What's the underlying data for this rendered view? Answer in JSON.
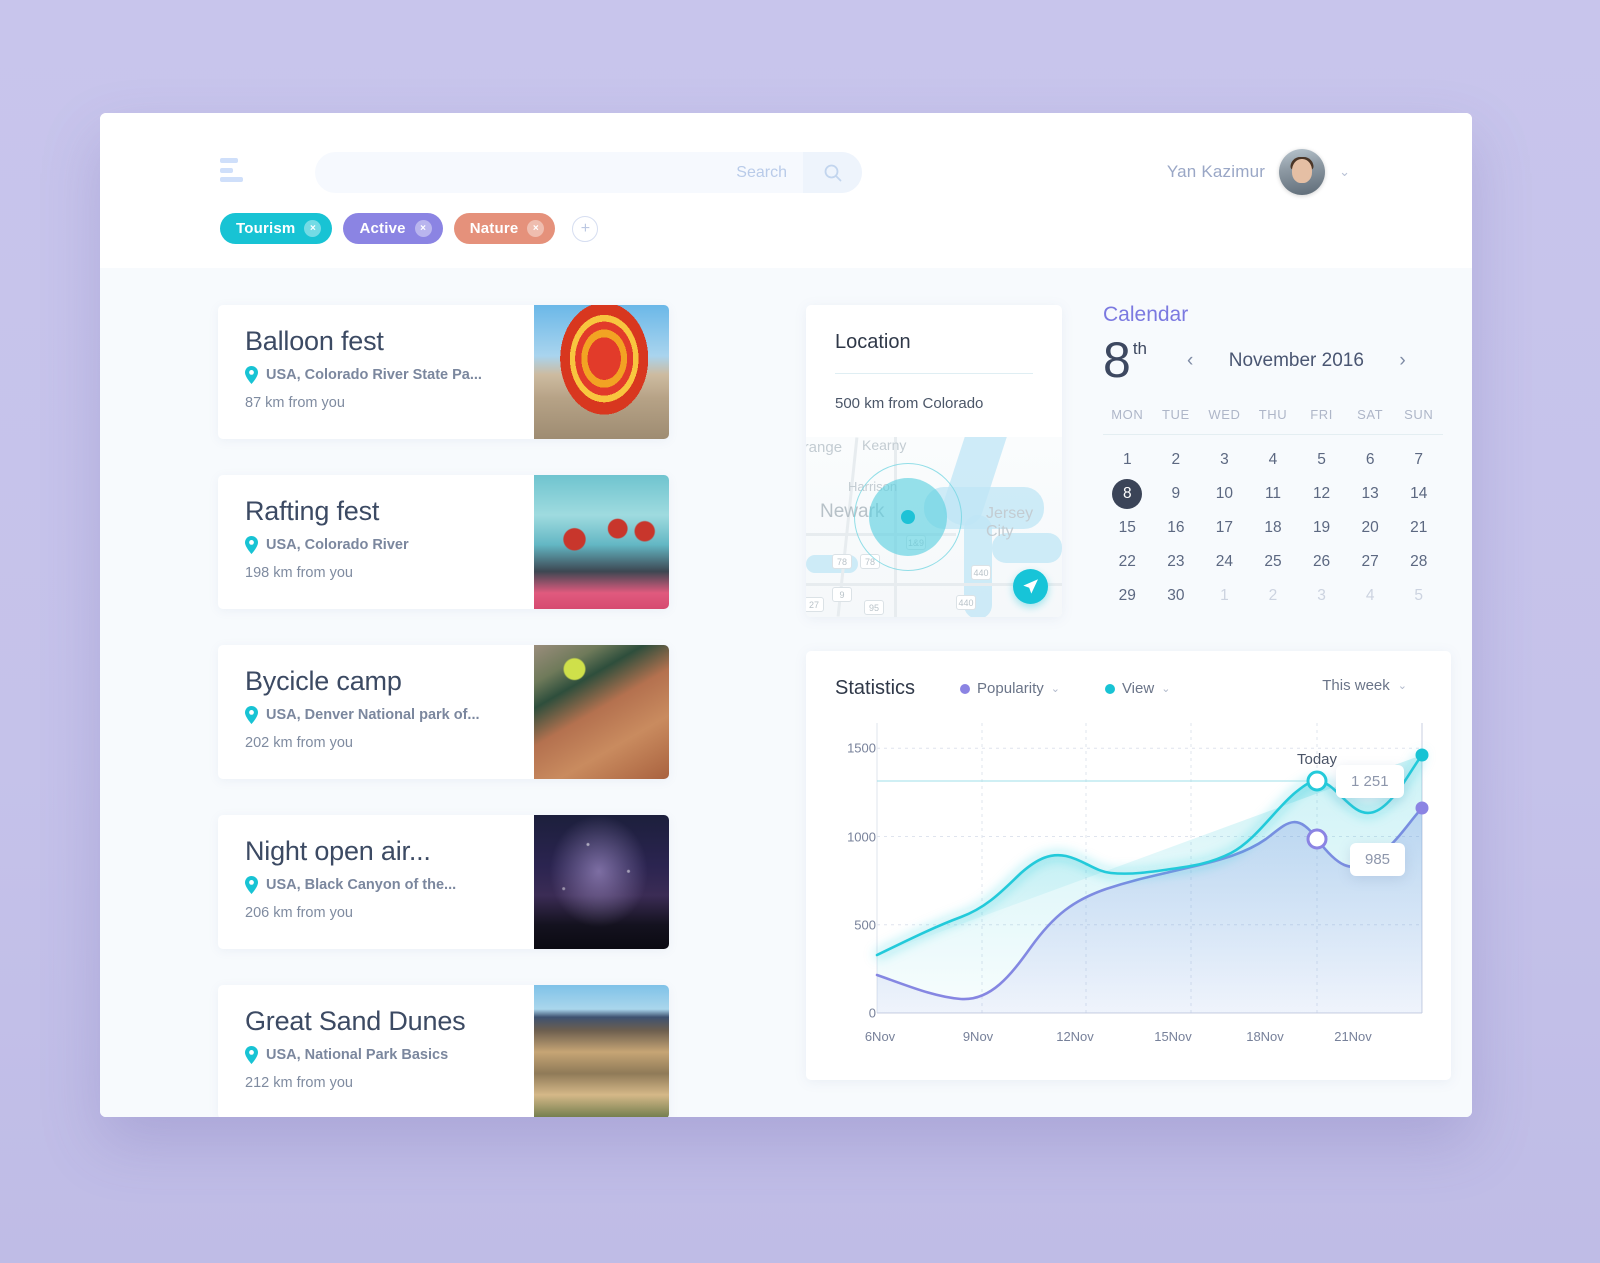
{
  "header": {
    "menu_icon": "hamburger-icon",
    "search": {
      "placeholder": "Search",
      "value": "",
      "icon": "search-icon"
    },
    "user": {
      "name": "Yan Kazimur",
      "avatar": "user-avatar",
      "chevron": "⌄"
    }
  },
  "tags": [
    {
      "label": "Tourism",
      "color": "#18c3d4",
      "remove": "×"
    },
    {
      "label": "Active",
      "color": "#8b84e3",
      "remove": "×"
    },
    {
      "label": "Nature",
      "color": "#e5917b",
      "remove": "×"
    }
  ],
  "tag_add": "+",
  "events": [
    {
      "title": "Balloon fest",
      "location": "USA, Colorado River State Pa...",
      "distance": "87 km from you",
      "photo": "ph-balloon"
    },
    {
      "title": "Rafting fest",
      "location": "USA, Colorado River",
      "distance": "198 km from you",
      "photo": "ph-raft"
    },
    {
      "title": "Bycicle camp",
      "location": "USA, Denver National park of...",
      "distance": "202 km from you",
      "photo": "ph-bike"
    },
    {
      "title": "Night open air...",
      "location": "USA, Black Canyon of the...",
      "distance": "206 km from you",
      "photo": "ph-night"
    },
    {
      "title": "Great Sand Dunes",
      "location": "USA, National Park Basics",
      "distance": "212 km from you",
      "photo": "ph-dunes"
    }
  ],
  "location_card": {
    "title": "Location",
    "subtitle": "500 km from Colorado",
    "map_labels": [
      "Orange",
      "Kearny",
      "Harrison",
      "Newark",
      "Jersey City"
    ],
    "map_shields": [
      "78",
      "78",
      "9",
      "440",
      "440",
      "95",
      "27",
      "1&9"
    ],
    "fab_icon": "navigate-icon"
  },
  "calendar": {
    "title": "Calendar",
    "day": "8",
    "day_suffix": "th",
    "month": "November 2016",
    "prev": "‹",
    "next": "›",
    "dow": [
      "MON",
      "TUE",
      "WED",
      "THU",
      "FRI",
      "SAT",
      "SUN"
    ],
    "weeks": [
      [
        {
          "d": "1"
        },
        {
          "d": "2"
        },
        {
          "d": "3"
        },
        {
          "d": "4"
        },
        {
          "d": "5"
        },
        {
          "d": "6"
        },
        {
          "d": "7"
        }
      ],
      [
        {
          "d": "8",
          "selected": true
        },
        {
          "d": "9"
        },
        {
          "d": "10"
        },
        {
          "d": "11"
        },
        {
          "d": "12"
        },
        {
          "d": "13"
        },
        {
          "d": "14"
        }
      ],
      [
        {
          "d": "15"
        },
        {
          "d": "16"
        },
        {
          "d": "17"
        },
        {
          "d": "18"
        },
        {
          "d": "19"
        },
        {
          "d": "20"
        },
        {
          "d": "21"
        }
      ],
      [
        {
          "d": "22"
        },
        {
          "d": "23"
        },
        {
          "d": "24"
        },
        {
          "d": "25"
        },
        {
          "d": "26"
        },
        {
          "d": "27"
        },
        {
          "d": "28"
        }
      ],
      [
        {
          "d": "29"
        },
        {
          "d": "30"
        },
        {
          "d": "1",
          "muted": true
        },
        {
          "d": "2",
          "muted": true
        },
        {
          "d": "3",
          "muted": true
        },
        {
          "d": "4",
          "muted": true
        },
        {
          "d": "5",
          "muted": true
        }
      ]
    ]
  },
  "statistics": {
    "title": "Statistics",
    "legend": [
      {
        "label": "Popularity",
        "color": "#8b84e3",
        "chevron": "⌄"
      },
      {
        "label": "View",
        "color": "#18c3d4",
        "chevron": "⌄"
      }
    ],
    "period": {
      "label": "This week",
      "chevron": "⌄"
    }
  },
  "chart_data": {
    "type": "area",
    "title": "Statistics",
    "xlabel": "",
    "ylabel": "",
    "ylim": [
      0,
      1700
    ],
    "yticks": [
      0,
      500,
      1000,
      1500
    ],
    "xticks": [
      "6Nov",
      "9Nov",
      "12Nov",
      "15Nov",
      "18Nov",
      "21Nov"
    ],
    "grid": true,
    "legend_position": "top",
    "annotations": [
      {
        "text": "Today",
        "x": "18Nov"
      },
      {
        "text": "1 251",
        "series": "View",
        "x": "18Nov",
        "value": 1251
      },
      {
        "text": "985",
        "series": "Popularity",
        "x": "18Nov",
        "value": 985
      }
    ],
    "x": [
      "6Nov",
      "7Nov",
      "8Nov",
      "9Nov",
      "10Nov",
      "11Nov",
      "12Nov",
      "13Nov",
      "14Nov",
      "15Nov",
      "16Nov",
      "17Nov",
      "18Nov",
      "19Nov",
      "20Nov",
      "21Nov",
      "22Nov"
    ],
    "series": [
      {
        "name": "View",
        "color": "#18c3d4",
        "values": [
          330,
          400,
          480,
          560,
          700,
          820,
          870,
          800,
          770,
          780,
          820,
          1000,
          1251,
          1090,
          940,
          1010,
          1330
        ]
      },
      {
        "name": "Popularity",
        "color": "#8b84e3",
        "values": [
          215,
          140,
          80,
          60,
          90,
          190,
          330,
          450,
          540,
          600,
          620,
          720,
          985,
          940,
          880,
          950,
          1160
        ]
      }
    ]
  }
}
